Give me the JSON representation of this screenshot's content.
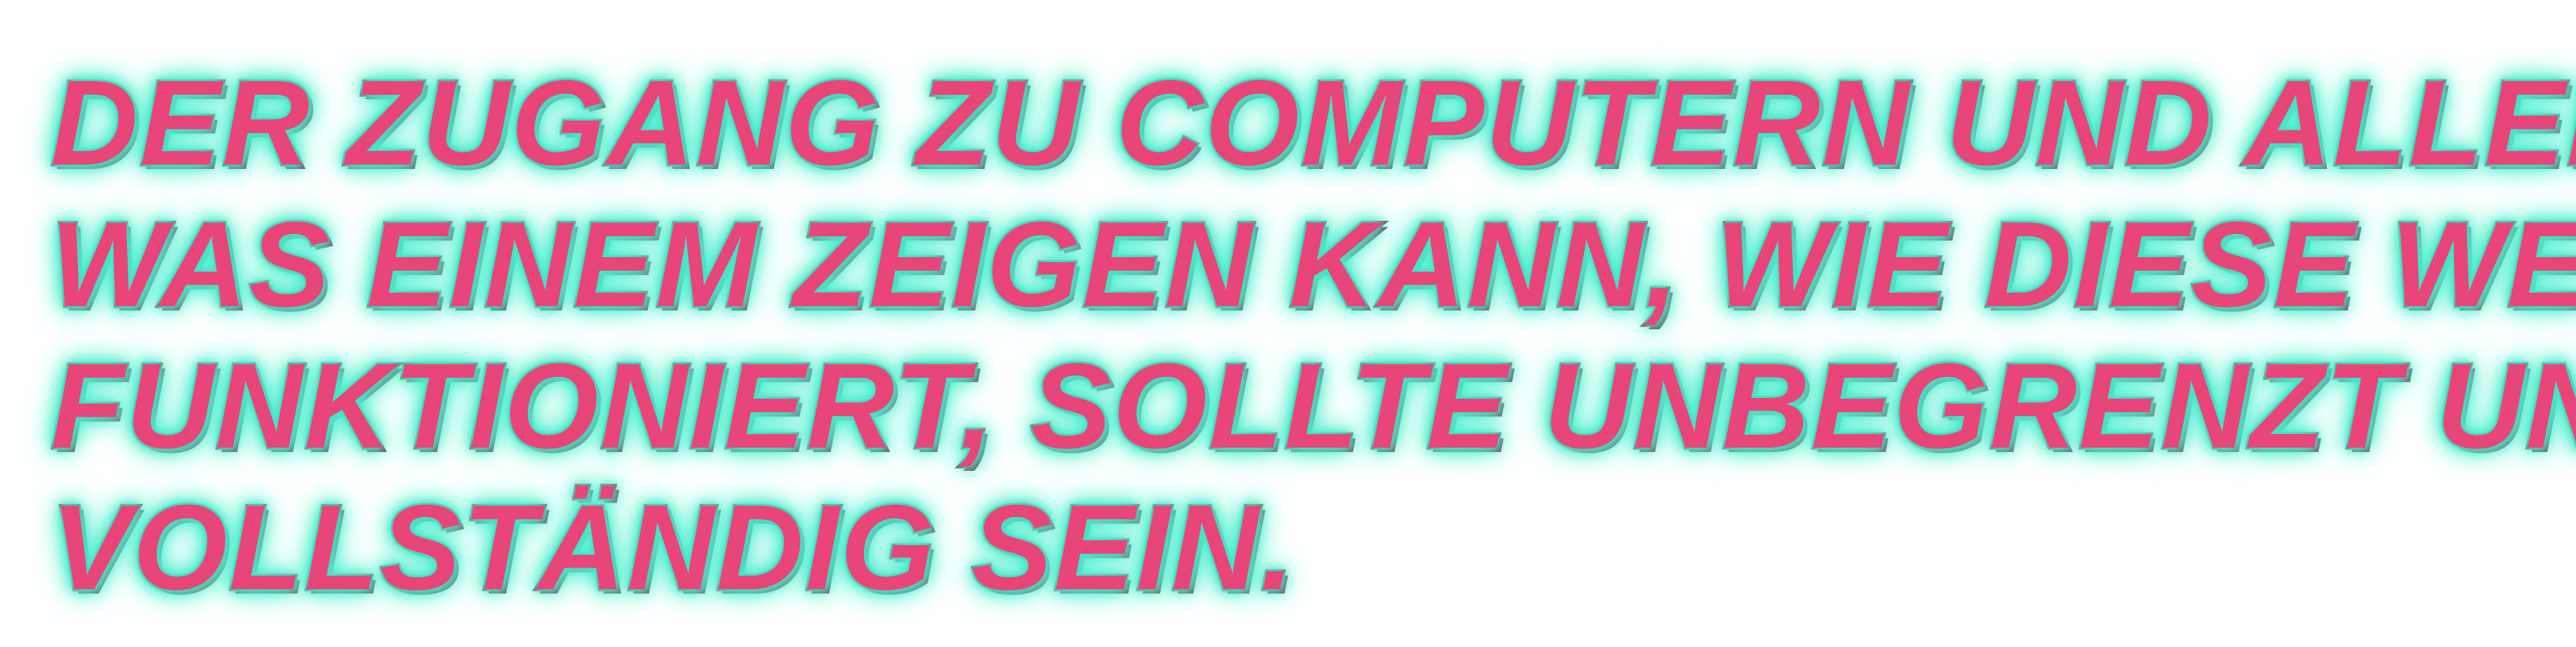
{
  "headline": {
    "lines": [
      "DER ZUGANG ZU COMPUTERN UND ALLEM,",
      "WAS EINEM ZEIGEN KANN, WIE DIESE WELT",
      "FUNKTIONIERT, SOLLTE UNBEGRENZT UND",
      "VOLLSTÄNDIG SEIN."
    ]
  },
  "colors": {
    "text_fill": "#e8457a",
    "text_outline": "#8a1a3f",
    "glow": "#3fe6c2",
    "background": "#ffffff"
  }
}
